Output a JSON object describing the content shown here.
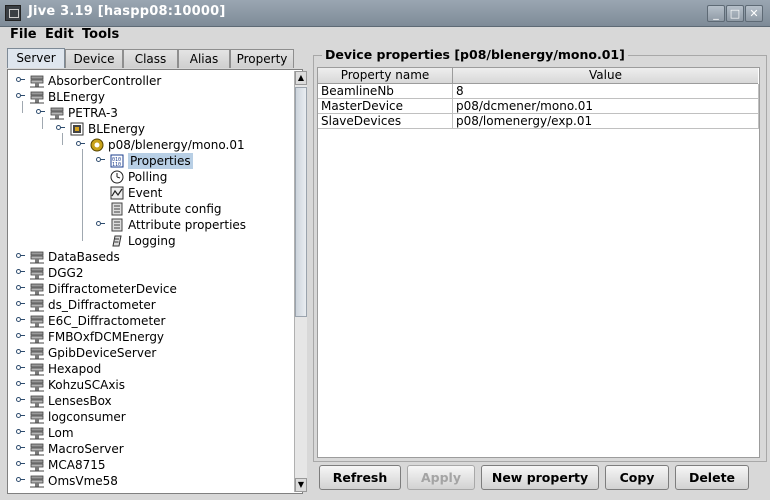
{
  "window": {
    "title": "Jive 3.19  [haspp08:10000]"
  },
  "menu": [
    "File",
    "Edit",
    "Tools"
  ],
  "tabs": [
    "Server",
    "Device",
    "Class",
    "Alias",
    "Property"
  ],
  "tree": [
    "AbsorberController",
    "BLEnergy",
    "PETRA-3",
    "BLEnergy",
    "p08/blenergy/mono.01",
    "Properties",
    "Polling",
    "Event",
    "Attribute config",
    "Attribute properties",
    "Logging",
    "DataBaseds",
    "DGG2",
    "DiffractometerDevice",
    "ds_Diffractometer",
    "E6C_Diffractometer",
    "FMBOxfDCMEnergy",
    "GpibDeviceServer",
    "Hexapod",
    "KohzuSCAxis",
    "LensesBox",
    "logconsumer",
    "Lom",
    "MacroServer",
    "MCA8715",
    "OmsVme58"
  ],
  "panel": {
    "title": "Device properties [p08/blenergy/mono.01]",
    "columns": [
      "Property name",
      "Value"
    ],
    "rows": [
      [
        "BeamlineNb",
        "8"
      ],
      [
        "MasterDevice",
        "p08/dcmener/mono.01"
      ],
      [
        "SlaveDevices",
        "p08/lomenergy/exp.01"
      ]
    ]
  },
  "buttons": [
    "Refresh",
    "Apply",
    "New property",
    "Copy",
    "Delete"
  ],
  "colors": {
    "selection": "#b8cfe5",
    "titlebar": "#8a96a3"
  }
}
